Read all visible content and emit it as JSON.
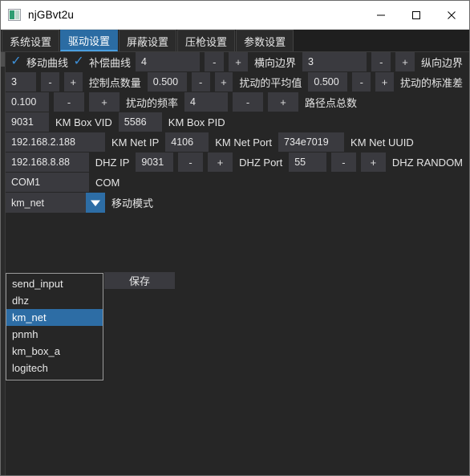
{
  "window": {
    "title": "njGBvt2u",
    "icon": "app-icon",
    "minimize_label": "—",
    "maximize_label": "□",
    "close_label": "✕"
  },
  "tabs": [
    {
      "label": "系统设置",
      "active": false
    },
    {
      "label": "驱动设置",
      "active": true
    },
    {
      "label": "屏蔽设置",
      "active": false
    },
    {
      "label": "压枪设置",
      "active": false
    },
    {
      "label": "参数设置",
      "active": false
    }
  ],
  "minus_label": "-",
  "plus_label": "+",
  "check_mark": "✓",
  "row1": {
    "check1_label": "移动曲线",
    "check2_label": "补偿曲线",
    "field1_value": "4",
    "label1": "横向边界",
    "field2_value": "3",
    "label2": "纵向边界"
  },
  "row2": {
    "field1_value": "3",
    "label1": "控制点数量",
    "field2_value": "0.500",
    "label2": "扰动的平均值",
    "field3_value": "0.500",
    "label3": "扰动的标准差"
  },
  "row3": {
    "field1_value": "0.100",
    "label1": "扰动的频率",
    "field2_value": "4",
    "label2": "路径点总数"
  },
  "row4": {
    "field1_value": "9031",
    "label1": "KM Box VID",
    "field2_value": "5586",
    "label2": "KM Box PID"
  },
  "row5": {
    "field1_value": "192.168.2.188",
    "label1": "KM Net IP",
    "field2_value": "4106",
    "label2": "KM Net Port",
    "field3_value": "734e7019",
    "label3": "KM Net UUID"
  },
  "row6": {
    "field1_value": "192.168.8.88",
    "label1": "DHZ IP",
    "field2_value": "9031",
    "label2": "DHZ Port",
    "field3_value": "55",
    "label3": "DHZ RANDOM"
  },
  "row7": {
    "field1_value": "COM1",
    "label1": "COM"
  },
  "combo": {
    "value": "km_net",
    "label": "移动模式",
    "arrow_icon": "chevron-down-icon"
  },
  "save": {
    "label": "保存"
  },
  "dropdown": {
    "items": [
      {
        "label": "send_input",
        "selected": false
      },
      {
        "label": "dhz",
        "selected": false
      },
      {
        "label": "km_net",
        "selected": true
      },
      {
        "label": "pnmh",
        "selected": false
      },
      {
        "label": "km_box_a",
        "selected": false
      },
      {
        "label": "logitech",
        "selected": false
      }
    ]
  },
  "colors": {
    "accent": "#2d6da5",
    "accent_bright": "#4a9fe0",
    "window_bg": "#262626",
    "field_bg": "#3a3a3f",
    "titlebar_bg": "#ffffff"
  }
}
